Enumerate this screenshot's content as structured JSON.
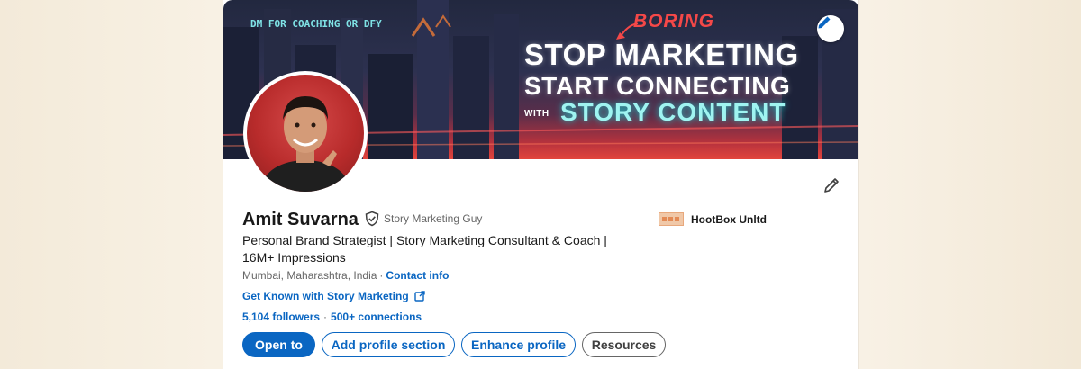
{
  "banner": {
    "dm_text": "DM FOR COACHING OR DFY",
    "boring_word": "BORING",
    "line1": "STOP MARKETING",
    "line2": "START CONNECTING",
    "with_word": "WITH",
    "line3": "STORY CONTENT"
  },
  "profile": {
    "name": "Amit Suvarna",
    "pronoun_label": "Story Marketing Guy",
    "headline": "Personal Brand Strategist | Story Marketing Consultant & Coach | 16M+ Impressions",
    "location": "Mumbai, Maharashtra, India",
    "location_separator": "·",
    "contact_info": "Contact info",
    "website": "Get Known with Story Marketing",
    "followers": "5,104 followers",
    "network_separator": "·",
    "connections": "500+ connections"
  },
  "company": {
    "name": "HootBox Unltd"
  },
  "actions": {
    "open_to": "Open to",
    "add_section": "Add profile section",
    "enhance": "Enhance profile",
    "resources": "Resources"
  },
  "colors": {
    "link_blue": "#0a66c2",
    "banner_red": "#e2453c",
    "neon_cyan": "#9ff4f1"
  },
  "icons": [
    "pencil-icon",
    "verified-shield-icon",
    "external-link-icon",
    "company-logo-icon"
  ]
}
